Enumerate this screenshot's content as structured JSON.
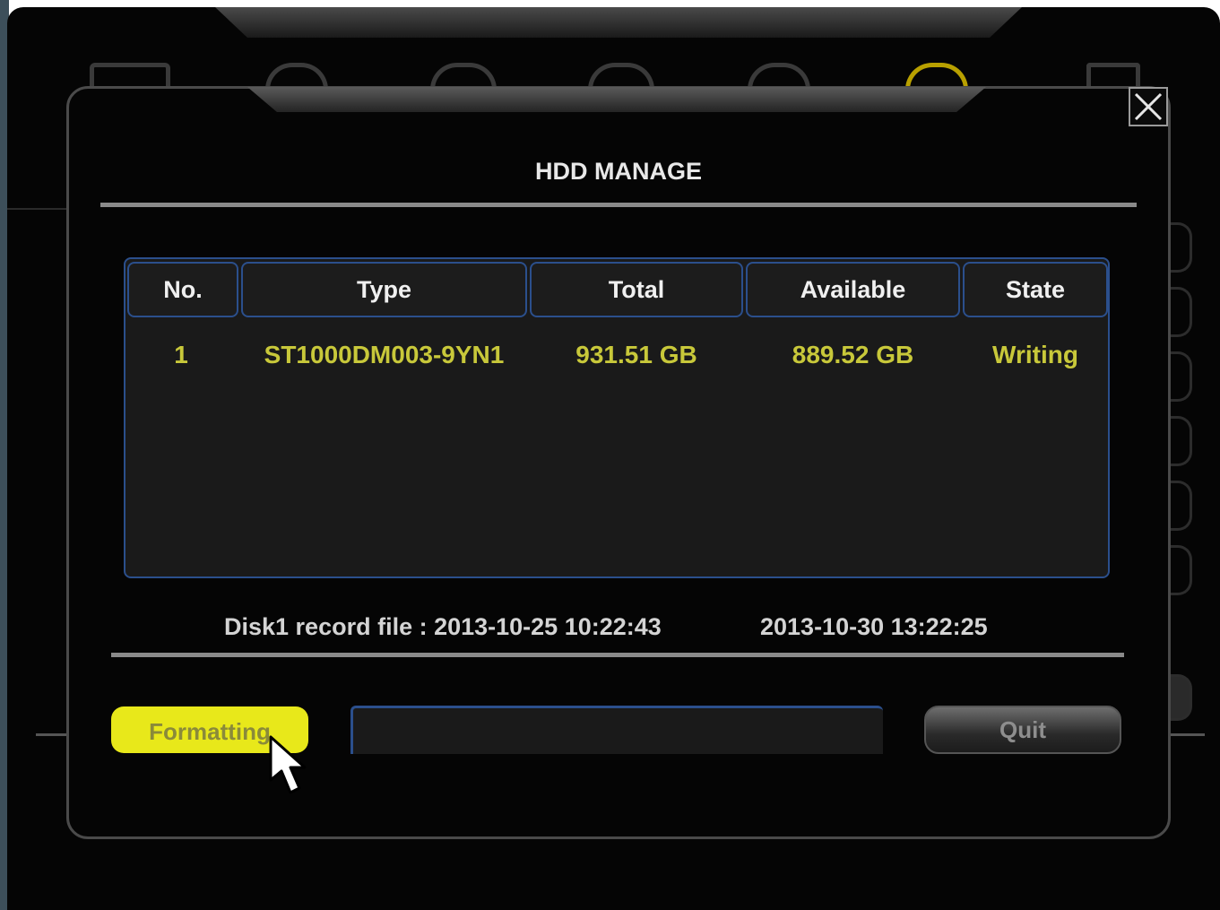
{
  "dialog": {
    "title": "HDD MANAGE",
    "close_icon": "close-icon"
  },
  "table": {
    "headers": [
      "No.",
      "Type",
      "Total",
      "Available",
      "State"
    ],
    "rows": [
      [
        "1",
        "ST1000DM003-9YN1",
        "931.51 GB",
        "889.52 GB",
        "Writing"
      ]
    ]
  },
  "record": {
    "label": "Disk1 record file : 2013-10-25 10:22:43",
    "end_time": "2013-10-30 13:22:25"
  },
  "buttons": {
    "format_label": "Formatting",
    "quit_label": "Quit"
  },
  "colors": {
    "row_text": "#c8c83a",
    "accent_border": "#2b4f8c",
    "format_button": "#e8e81a"
  }
}
